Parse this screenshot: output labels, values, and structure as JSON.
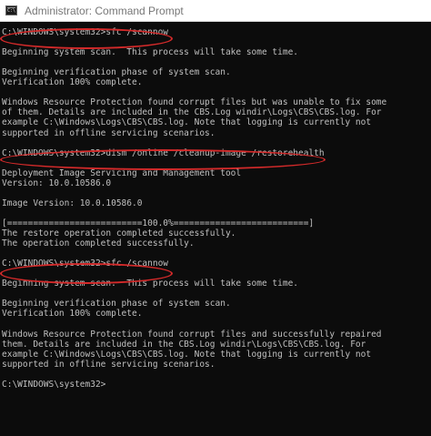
{
  "window": {
    "title": "Administrator: Command Prompt",
    "icon": "cmd-console-icon"
  },
  "console": {
    "lines": [
      "C:\\WINDOWS\\system32>sfc /scannow",
      "",
      "Beginning system scan.  This process will take some time.",
      "",
      "Beginning verification phase of system scan.",
      "Verification 100% complete.",
      "",
      "Windows Resource Protection found corrupt files but was unable to fix some",
      "of them. Details are included in the CBS.Log windir\\Logs\\CBS\\CBS.log. For",
      "example C:\\Windows\\Logs\\CBS\\CBS.log. Note that logging is currently not",
      "supported in offline servicing scenarios.",
      "",
      "C:\\WINDOWS\\system32>dism /online /cleanup-image /restorehealth",
      "",
      "Deployment Image Servicing and Management tool",
      "Version: 10.0.10586.0",
      "",
      "Image Version: 10.0.10586.0",
      "",
      "[==========================100.0%==========================]",
      "The restore operation completed successfully.",
      "The operation completed successfully.",
      "",
      "C:\\WINDOWS\\system32>sfc /scannow",
      "",
      "Beginning system scan.  This process will take some time.",
      "",
      "Beginning verification phase of system scan.",
      "Verification 100% complete.",
      "",
      "Windows Resource Protection found corrupt files and successfully repaired",
      "them. Details are included in the CBS.Log windir\\Logs\\CBS\\CBS.log. For",
      "example C:\\Windows\\Logs\\CBS\\CBS.log. Note that logging is currently not",
      "supported in offline servicing scenarios.",
      "",
      "C:\\WINDOWS\\system32>"
    ],
    "highlight_color": "#d42a2a"
  },
  "colors": {
    "console_bg": "#0c0c0c",
    "console_text": "#c0c0c0",
    "titlebar_bg": "#ffffff",
    "title_text": "#777777"
  }
}
